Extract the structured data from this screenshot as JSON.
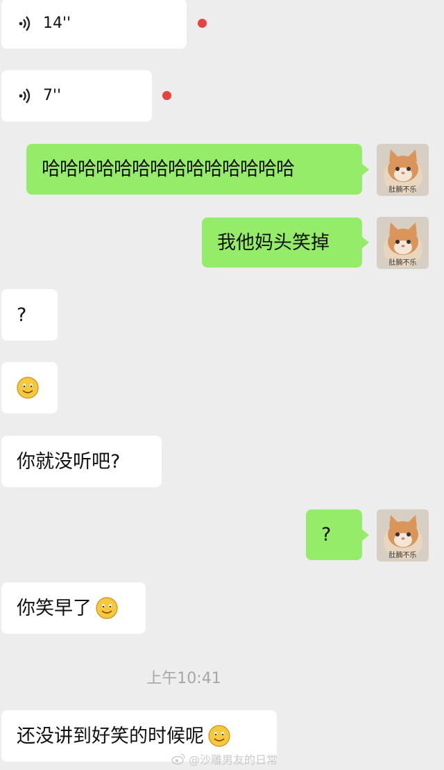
{
  "messages": [
    {
      "type": "voice",
      "side": "left",
      "duration": "14''",
      "unread": true
    },
    {
      "type": "voice",
      "side": "left",
      "duration": "7''",
      "unread": true
    },
    {
      "type": "text",
      "side": "right",
      "text": "哈哈哈哈哈哈哈哈哈哈哈哈哈哈"
    },
    {
      "type": "text",
      "side": "right",
      "text": "我他妈头笑掉"
    },
    {
      "type": "text",
      "side": "left",
      "text": "?"
    },
    {
      "type": "emoji",
      "side": "left",
      "emoji": "smile-icon"
    },
    {
      "type": "text",
      "side": "left",
      "text": "你就没听吧?"
    },
    {
      "type": "text",
      "side": "right",
      "text": "?"
    },
    {
      "type": "text",
      "side": "left",
      "text": "你笑早了",
      "emoji": "smile-icon"
    },
    {
      "type": "text",
      "side": "left",
      "text": "还没讲到好笑的时候呢",
      "emoji": "smile-icon"
    }
  ],
  "timestamp": "上午10:41",
  "avatar": {
    "caption": "肚腩不乐",
    "description": "cat-avatar"
  },
  "watermark": "@沙雕男友的日常",
  "colors": {
    "background": "#ededed",
    "sent_bubble": "#95ec69",
    "received_bubble": "#ffffff",
    "unread_dot": "#e64340"
  }
}
